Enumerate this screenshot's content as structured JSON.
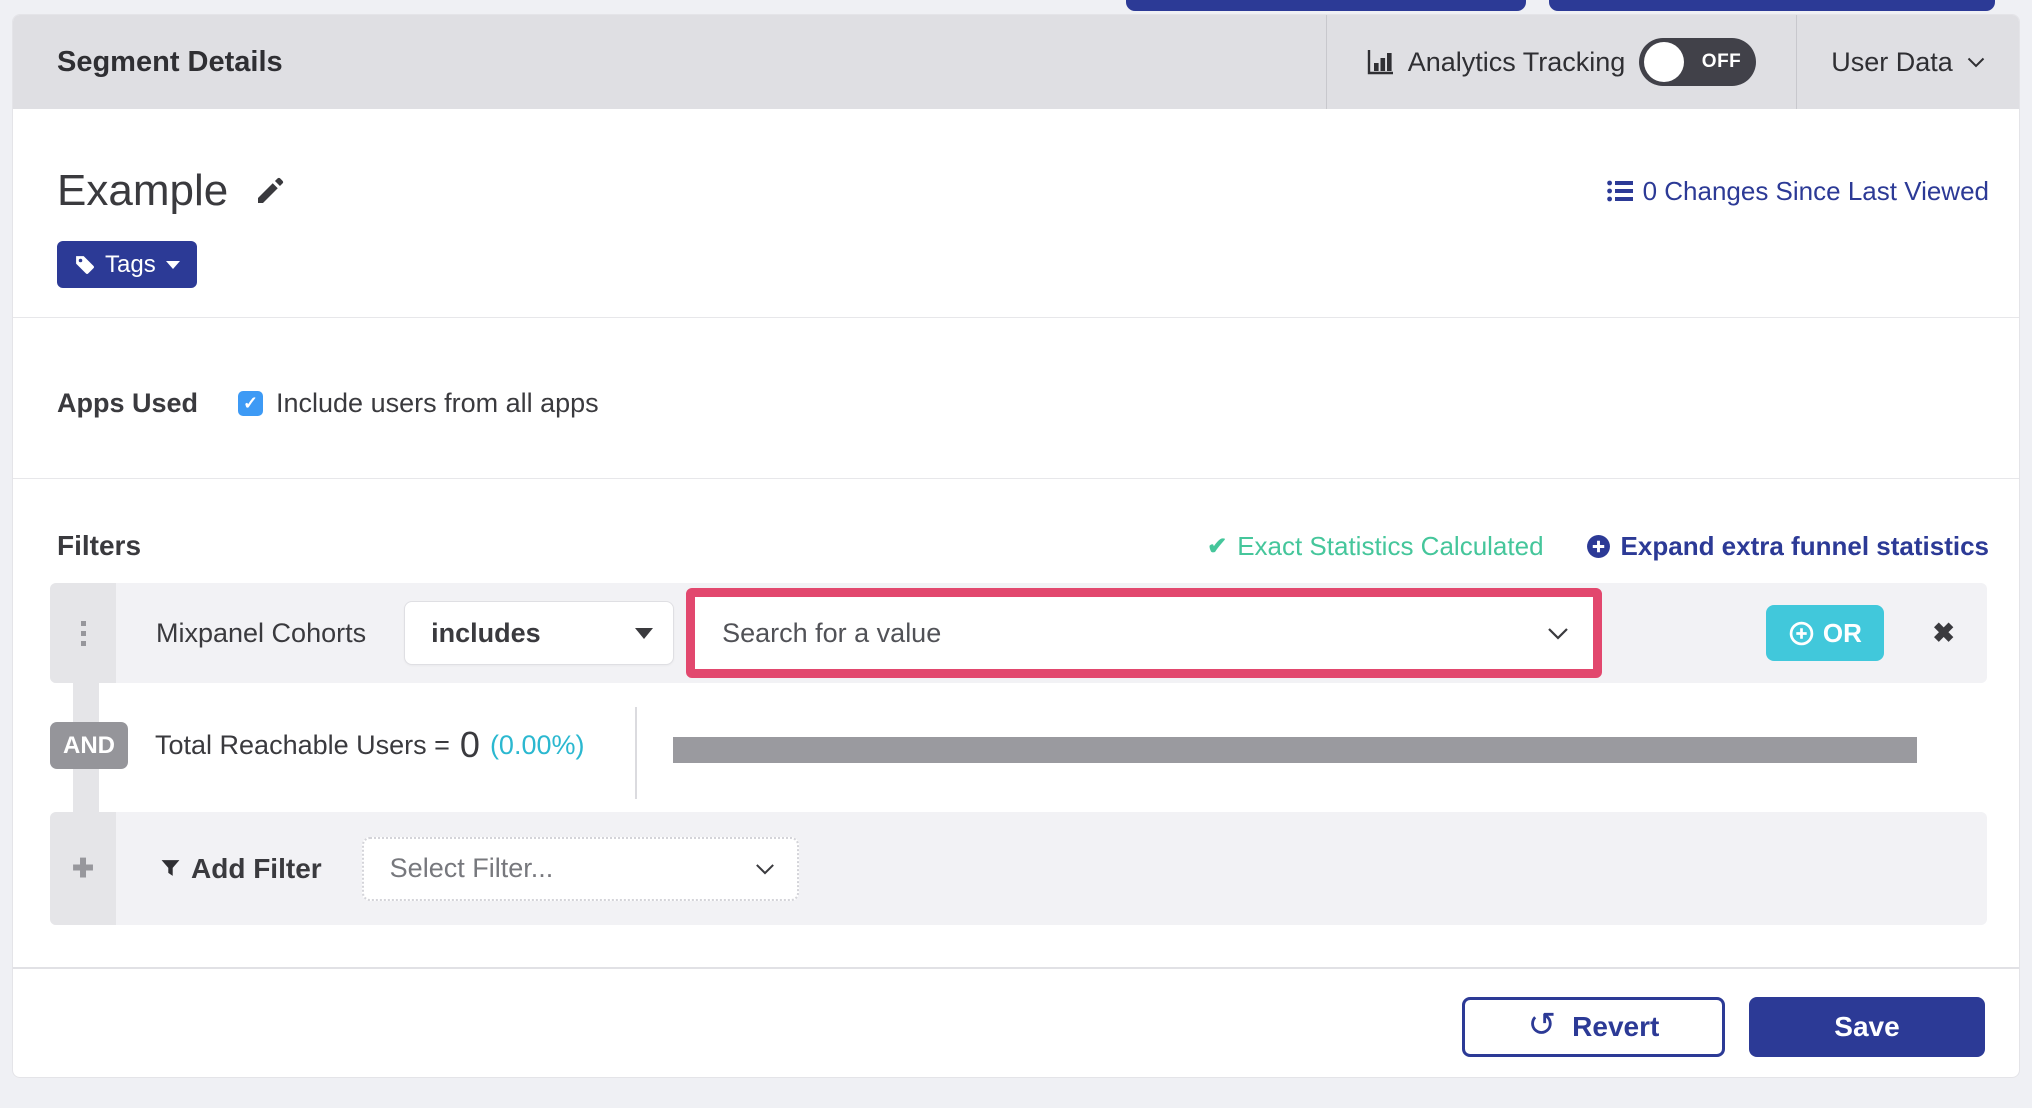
{
  "colors": {
    "indigo": "#2C3A96",
    "teal": "#41C8DB",
    "green": "#45C69B",
    "cyan": "#2BB8D0",
    "pink": "#E2486E",
    "header-bg": "#DFDFE3",
    "row-bg": "#F2F2F5",
    "gutter-bg": "#E5E5E8",
    "badge-gray": "#95959A",
    "bar-gray": "#9A9A9F",
    "toggle-bg": "#414149",
    "checkbox-blue": "#3D9AF5",
    "text-dark": "#3A3A3E",
    "page-bg": "#EFF0F4"
  },
  "header": {
    "title": "Segment Details",
    "analytics_label": "Analytics Tracking",
    "toggle_label": "OFF",
    "user_menu_label": "User Data"
  },
  "segment": {
    "name": "Example",
    "changes_link": "0 Changes Since Last Viewed",
    "tags_button_label": "Tags"
  },
  "apps_used": {
    "label": "Apps Used",
    "checkbox_label": "Include users from all apps"
  },
  "filters": {
    "heading": "Filters",
    "status_text": "Exact Statistics Calculated",
    "expand_link": "Expand extra funnel statistics",
    "filter_row": {
      "field_label": "Mixpanel Cohorts",
      "operator_value": "includes",
      "value_placeholder": "Search for a value",
      "or_button_label": "OR"
    },
    "and_badge": "AND",
    "reachable_label": "Total Reachable Users =",
    "reachable_value": "0",
    "reachable_percent": "(0.00%)",
    "add_filter_label": "Add Filter",
    "select_filter_placeholder": "Select Filter..."
  },
  "footer": {
    "revert_label": "Revert",
    "save_label": "Save"
  },
  "glyphs": {
    "check": "✔",
    "checkmark": "✓",
    "close": "✖",
    "plus": "✚",
    "revert_arrow": "↺"
  }
}
